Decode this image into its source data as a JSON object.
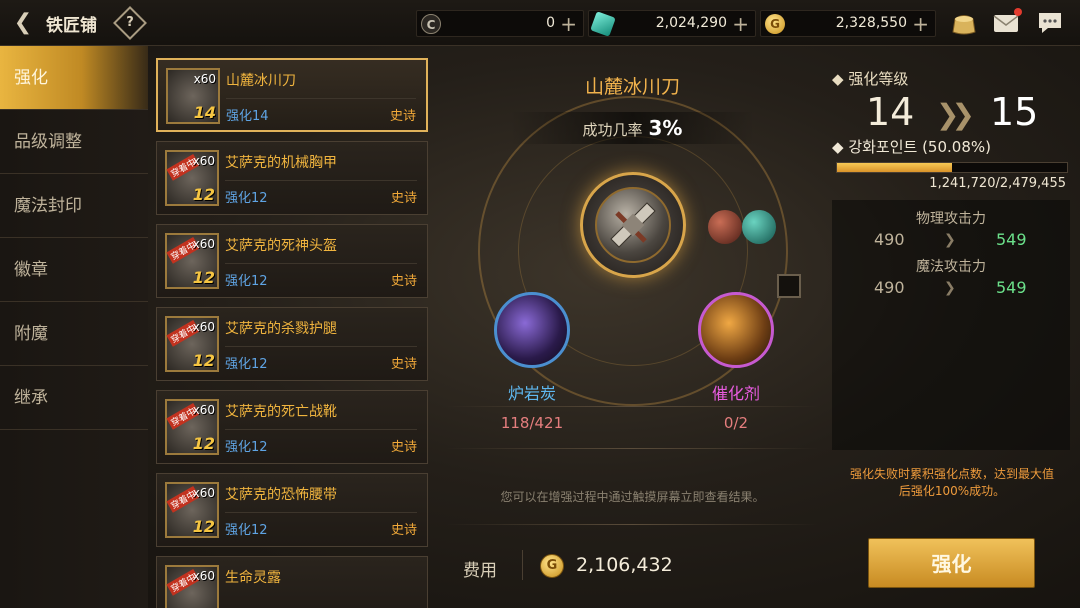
{
  "header": {
    "back_icon": "back-arrow-icon",
    "title": "铁匠铺",
    "help": "?",
    "currencies": [
      {
        "icon": "crystal-coin-icon",
        "symbol": "C",
        "value": "0",
        "color": "#c9c3b3"
      },
      {
        "icon": "gem-icon",
        "symbol": "",
        "value": "2,024,290",
        "color": "#2fc4b0"
      },
      {
        "icon": "gold-coin-icon",
        "symbol": "G",
        "value": "2,328,550",
        "color": "#e5b33c"
      }
    ],
    "plus": "+"
  },
  "menu": {
    "items": [
      {
        "label": "强化",
        "active": true
      },
      {
        "label": "品级调整"
      },
      {
        "label": "魔法封印"
      },
      {
        "label": "徽章"
      },
      {
        "label": "附魔"
      },
      {
        "label": "继承"
      }
    ]
  },
  "list": {
    "items": [
      {
        "name": "山麓冰川刀",
        "level": "强化14",
        "grade": "史诗",
        "plus": "14",
        "lv": "x60",
        "selected": true
      },
      {
        "name": "艾萨克的机械胸甲",
        "level": "强化12",
        "grade": "史诗",
        "plus": "12",
        "lv": "x60",
        "tag": "穿着中"
      },
      {
        "name": "艾萨克的死神头盔",
        "level": "强化12",
        "grade": "史诗",
        "plus": "12",
        "lv": "x60",
        "tag": "穿着中"
      },
      {
        "name": "艾萨克的杀戮护腿",
        "level": "强化12",
        "grade": "史诗",
        "plus": "12",
        "lv": "x60",
        "tag": "穿着中"
      },
      {
        "name": "艾萨克的死亡战靴",
        "level": "强化12",
        "grade": "史诗",
        "plus": "12",
        "lv": "x60",
        "tag": "穿着中"
      },
      {
        "name": "艾萨克的恐怖腰带",
        "level": "强化12",
        "grade": "史诗",
        "plus": "12",
        "lv": "x60",
        "tag": "穿着中"
      },
      {
        "name": "生命灵露",
        "level": "",
        "grade": "",
        "plus": "",
        "lv": "x60",
        "tag": "穿着中"
      }
    ]
  },
  "center": {
    "target_name": "山麓冰川刀",
    "rate_label": "成功几率",
    "rate_value": "3%",
    "materials": [
      {
        "name": "炉岩炭",
        "count": "118/421",
        "color": "#5fb8f0"
      },
      {
        "name": "催化剂",
        "count": "0/2",
        "color": "#e85ce0"
      }
    ],
    "hint": "您可以在增强过程中通过触摸屏幕立即查看结果。",
    "cost_label": "费用",
    "cost_coin": "G",
    "cost_value": "2,106,432"
  },
  "right": {
    "enhance_label": "强化等级",
    "from_level": "14",
    "to_level": "15",
    "points_label": "강화포인트 (50.08%)",
    "points_progress": 0.5008,
    "points_value": "1,241,720/2,479,455",
    "stats": [
      {
        "name": "物理攻击力",
        "old": "490",
        "new": "549"
      },
      {
        "name": "魔法攻击力",
        "old": "490",
        "new": "549"
      }
    ],
    "fail_note_1": "强化失败时累积强化点数，达到最大值",
    "fail_note_2": "后强化100%成功。",
    "enhance_button": "强化"
  }
}
